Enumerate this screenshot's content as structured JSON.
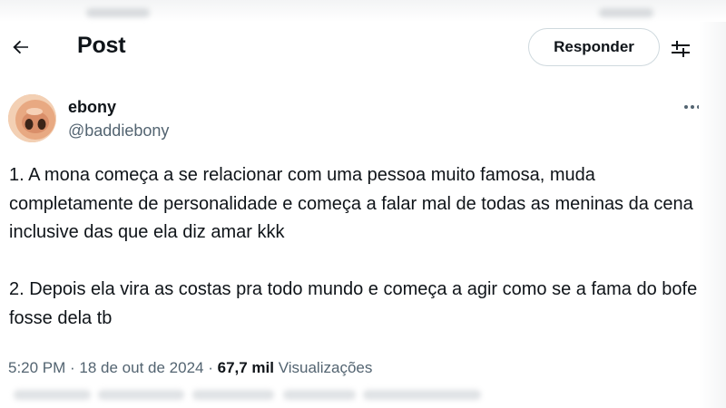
{
  "header": {
    "back_icon": "arrow-left-icon",
    "title": "Post",
    "reply_label": "Responder",
    "settings_icon": "sliders-icon"
  },
  "author": {
    "display_name": "ebony",
    "handle": "@baddiebony",
    "avatar_icon": "avatar",
    "more_icon": "more-horizontal-icon"
  },
  "tweet": {
    "paragraph_1": "1. A mona começa a se relacionar com uma pessoa muito famosa, muda completamente de personalidade e começa a falar mal de todas as meninas da cena inclusive das que ela diz amar kkk",
    "paragraph_2": "2. Depois ela vira as costas pra todo mundo e começa a agir como se a fama do bofe fosse dela tb"
  },
  "meta": {
    "time": "5:20 PM",
    "separator": " · ",
    "date": "18 de out de 2024",
    "views_count": "67,7 mil",
    "views_label": "Visualizações"
  },
  "colors": {
    "text_primary": "#0f1419",
    "text_secondary": "#536471",
    "button_border": "#cfd9de",
    "avatar_skin": "#e9b48f"
  }
}
